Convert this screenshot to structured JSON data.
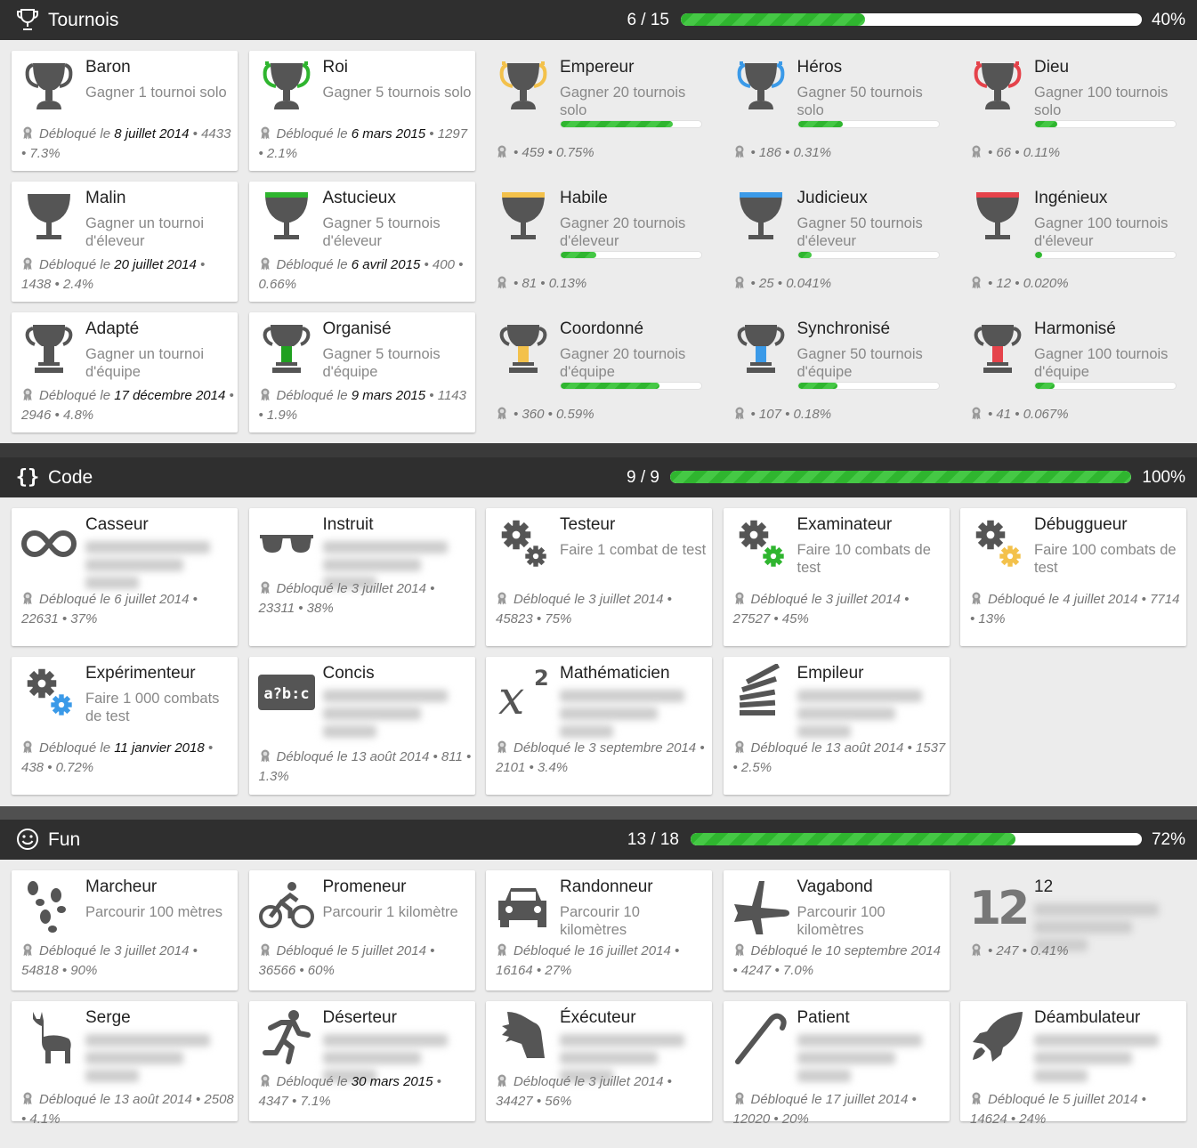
{
  "sections": {
    "tournois": {
      "title": "Tournois",
      "count": "6 / 15",
      "pct": "40%",
      "progress": 0.4,
      "cards": [
        {
          "name": "Baron",
          "desc": "Gagner 1 tournoi solo",
          "prefix": "Débloqué le",
          "date": "8 juillet 2014",
          "stats": "4433 • 7.3%",
          "unlocked": true
        },
        {
          "name": "Roi",
          "desc": "Gagner 5 tournois solo",
          "prefix": "Débloqué le",
          "date": "6 mars 2015",
          "stats": "1297 • 2.1%",
          "unlocked": true
        },
        {
          "name": "Empereur",
          "desc": "Gagner 20 tournois solo",
          "stats": "• 459 • 0.75%",
          "progress": 0.8,
          "unlocked": false
        },
        {
          "name": "Héros",
          "desc": "Gagner 50 tournois solo",
          "stats": "• 186 • 0.31%",
          "progress": 0.32,
          "unlocked": false
        },
        {
          "name": "Dieu",
          "desc": "Gagner 100 tournois solo",
          "stats": "• 66 • 0.11%",
          "progress": 0.16,
          "unlocked": false
        },
        {
          "name": "Malin",
          "desc": "Gagner un tournoi d'éleveur",
          "prefix": "Débloqué le",
          "date": "20 juillet 2014",
          "stats": "1438 • 2.4%",
          "unlocked": true
        },
        {
          "name": "Astucieux",
          "desc": "Gagner 5 tournois d'éleveur",
          "prefix": "Débloqué le",
          "date": "6 avril 2015",
          "stats": "400 • 0.66%",
          "unlocked": true
        },
        {
          "name": "Habile",
          "desc": "Gagner 20 tournois d'éleveur",
          "stats": "• 81 • 0.13%",
          "progress": 0.25,
          "unlocked": false
        },
        {
          "name": "Judicieux",
          "desc": "Gagner 50 tournois d'éleveur",
          "stats": "• 25 • 0.041%",
          "progress": 0.1,
          "unlocked": false
        },
        {
          "name": "Ingénieux",
          "desc": "Gagner 100 tournois d'éleveur",
          "stats": "• 12 • 0.020%",
          "progress": 0.05,
          "unlocked": false
        },
        {
          "name": "Adapté",
          "desc": "Gagner un tournoi d'équipe",
          "prefix": "Débloqué le",
          "date": "17 décembre 2014",
          "stats": "2946 • 4.8%",
          "unlocked": true
        },
        {
          "name": "Organisé",
          "desc": "Gagner 5 tournois d'équipe",
          "prefix": "Débloqué le",
          "date": "9 mars 2015",
          "stats": "1143 • 1.9%",
          "unlocked": true
        },
        {
          "name": "Coordonné",
          "desc": "Gagner 20 tournois d'équipe",
          "stats": "• 360 • 0.59%",
          "progress": 0.7,
          "unlocked": false
        },
        {
          "name": "Synchronisé",
          "desc": "Gagner 50 tournois d'équipe",
          "stats": "• 107 • 0.18%",
          "progress": 0.28,
          "unlocked": false
        },
        {
          "name": "Harmonisé",
          "desc": "Gagner 100 tournois d'équipe",
          "stats": "• 41 • 0.067%",
          "progress": 0.14,
          "unlocked": false
        }
      ]
    },
    "code": {
      "title": "Code",
      "count": "9 / 9",
      "pct": "100%",
      "progress": 1.0,
      "cards": [
        {
          "name": "Casseur",
          "desc": "",
          "prefix": "Débloqué le 6 juillet 2014 •",
          "date": "",
          "stats": "22631 • 37%",
          "unlocked": true
        },
        {
          "name": "Instruit",
          "desc": "",
          "prefix": "Débloqué le 3 juillet 2014 •",
          "date": "",
          "stats": "23311 • 38%",
          "unlocked": true
        },
        {
          "name": "Testeur",
          "desc": "Faire 1 combat de test",
          "prefix": "Débloqué le 3 juillet 2014 •",
          "date": "",
          "stats": "45823 • 75%",
          "unlocked": true
        },
        {
          "name": "Examinateur",
          "desc": "Faire 10 combats de test",
          "prefix": "Débloqué le 3 juillet 2014 •",
          "date": "",
          "stats": "27527 • 45%",
          "unlocked": true
        },
        {
          "name": "Débuggueur",
          "desc": "Faire 100 combats de test",
          "prefix": "Débloqué le 4 juillet 2014 •",
          "date": "",
          "stats": "7714 • 13%",
          "unlocked": true
        },
        {
          "name": "Expérimenteur",
          "desc": "Faire 1 000 combats de test",
          "prefix": "Débloqué le",
          "date": "11 janvier 2018",
          "stats": "438 • 0.72%",
          "unlocked": true
        },
        {
          "name": "Concis",
          "desc": "",
          "prefix": "Débloqué le 13 août 2014 •",
          "date": "",
          "stats": "811 • 1.3%",
          "unlocked": true
        },
        {
          "name": "Mathématicien",
          "desc": "",
          "prefix": "Débloqué le 3 septembre",
          "date": "",
          "stats": "2014 • 2101 • 3.4%",
          "unlocked": true
        },
        {
          "name": "Empileur",
          "desc": "",
          "prefix": "Débloqué le 13 août 2014 •",
          "date": "",
          "stats": "1537 • 2.5%",
          "unlocked": true
        }
      ]
    },
    "fun": {
      "title": "Fun",
      "count": "13 / 18",
      "pct": "72%",
      "progress": 0.72,
      "cards": [
        {
          "name": "Marcheur",
          "desc": "Parcourir 100 mètres",
          "prefix": "Débloqué le 3 juillet 2014 •",
          "date": "",
          "stats": "54818 • 90%",
          "unlocked": true
        },
        {
          "name": "Promeneur",
          "desc": "Parcourir 1 kilomètre",
          "prefix": "Débloqué le 5 juillet 2014 •",
          "date": "",
          "stats": "36566 • 60%",
          "unlocked": true
        },
        {
          "name": "Randonneur",
          "desc": "Parcourir 10 kilomètres",
          "prefix": "Débloqué le 16 juillet 2014 •",
          "date": "",
          "stats": "16164 • 27%",
          "unlocked": true
        },
        {
          "name": "Vagabond",
          "desc": "Parcourir 100 kilomètres",
          "prefix": "Débloqué le 10 septembre",
          "date": "",
          "stats": "2014 • 4247 • 7.0%",
          "unlocked": true
        },
        {
          "name": "12",
          "desc": "",
          "stats": "• 247 • 0.41%",
          "unlocked": false
        },
        {
          "name": "Serge",
          "desc": "",
          "prefix": "Débloqué le 13 août 2014 •",
          "date": "",
          "stats": "2508 • 4.1%",
          "unlocked": true
        },
        {
          "name": "Déserteur",
          "desc": "",
          "prefix": "Débloqué le",
          "date": "30 mars 2015",
          "stats": "4347 • 7.1%",
          "unlocked": true
        },
        {
          "name": "Éxécuteur",
          "desc": "",
          "prefix": "Débloqué le 3 juillet 2014 •",
          "date": "",
          "stats": "34427 • 56%",
          "unlocked": true
        },
        {
          "name": "Patient",
          "desc": "",
          "prefix": "Débloqué le 17 juillet 2014 •",
          "date": "",
          "stats": "12020 • 20%",
          "unlocked": true
        },
        {
          "name": "Déambulateur",
          "desc": "",
          "prefix": "Débloqué le 5 juillet 2014 •",
          "date": "",
          "stats": "14624 • 24%",
          "unlocked": true
        }
      ]
    }
  },
  "colors": {
    "green": "#2fb52f",
    "gold": "#f3c14b",
    "blue": "#3b9ae8",
    "red": "#e5434b",
    "greenbadge": "#20a020",
    "icon": "#555555"
  }
}
